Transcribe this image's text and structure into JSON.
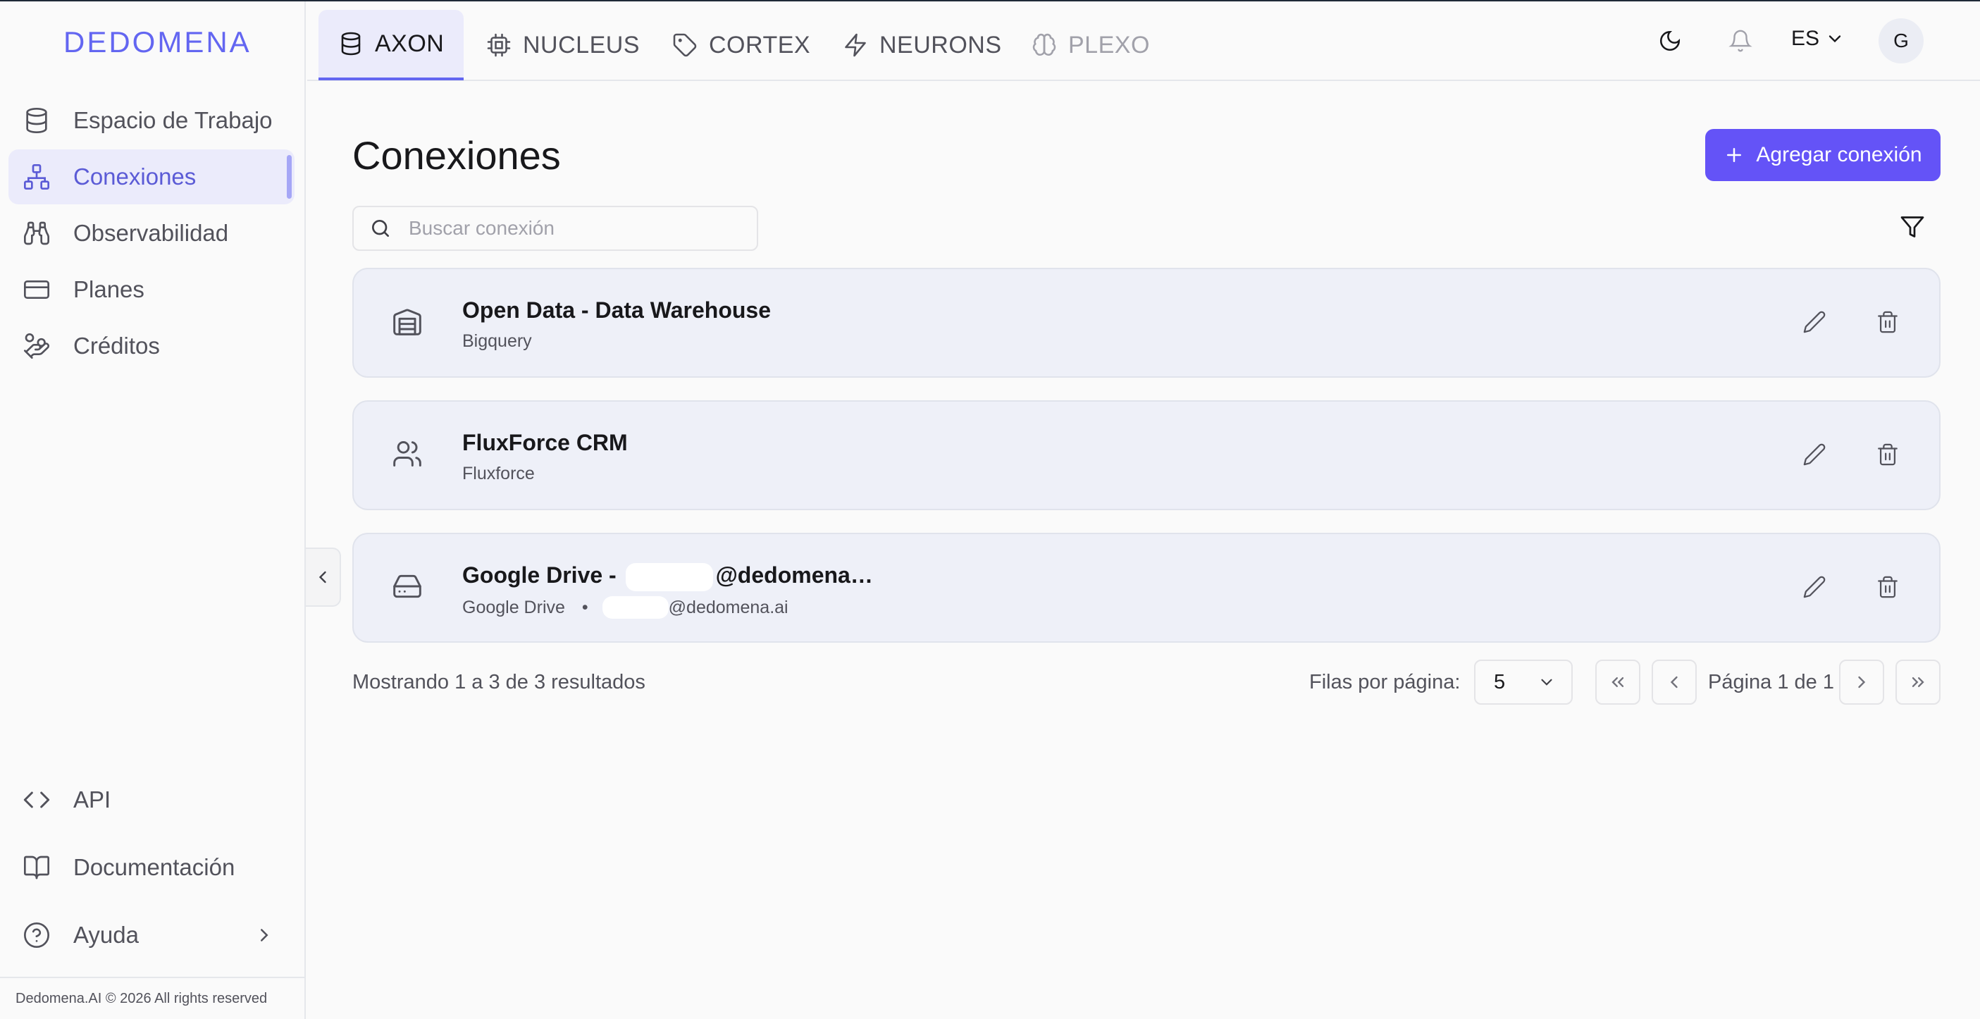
{
  "brand": {
    "logo_text": "DEDOMENA",
    "accent": "#6366f1",
    "button_color": "#6453f7"
  },
  "sidebar": {
    "items": [
      {
        "label": "Espacio de Trabajo",
        "icon": "database-icon"
      },
      {
        "label": "Conexiones",
        "icon": "network-icon",
        "active": true
      },
      {
        "label": "Observabilidad",
        "icon": "binoculars-icon"
      },
      {
        "label": "Planes",
        "icon": "credit-card-icon"
      },
      {
        "label": "Créditos",
        "icon": "hand-coins-icon"
      }
    ],
    "bottom_items": [
      {
        "label": "API",
        "icon": "code-icon"
      },
      {
        "label": "Documentación",
        "icon": "book-icon"
      },
      {
        "label": "Ayuda",
        "icon": "help-circle-icon"
      }
    ],
    "footer": "Dedomena.AI © 2026 All rights reserved"
  },
  "header": {
    "tabs": [
      {
        "label": "AXON",
        "icon": "database-icon",
        "active": true
      },
      {
        "label": "NUCLEUS",
        "icon": "cpu-icon"
      },
      {
        "label": "CORTEX",
        "icon": "tag-icon"
      },
      {
        "label": "NEURONS",
        "icon": "zap-icon"
      },
      {
        "label": "PLEXO",
        "icon": "brain-icon",
        "disabled": true
      }
    ],
    "language": "ES",
    "avatar_initial": "G"
  },
  "main": {
    "title": "Conexiones",
    "add_button": "Agregar conexión",
    "search_placeholder": "Buscar conexión",
    "connections": [
      {
        "name": "Open Data - Data Warehouse",
        "type": "Bigquery",
        "icon": "warehouse-icon"
      },
      {
        "name": "FluxForce CRM",
        "type": "Fluxforce",
        "icon": "users-icon"
      },
      {
        "name_prefix": "Google Drive - ",
        "name_suffix": "@dedomena…",
        "type": "Google Drive",
        "account_suffix": "@dedomena.ai",
        "icon": "hard-drive-icon"
      }
    ],
    "results_text": "Mostrando 1 a 3 de 3 resultados",
    "rows_per_page_label": "Filas por página:",
    "rows_per_page_value": "5",
    "page_info": "Página 1 de 1"
  }
}
